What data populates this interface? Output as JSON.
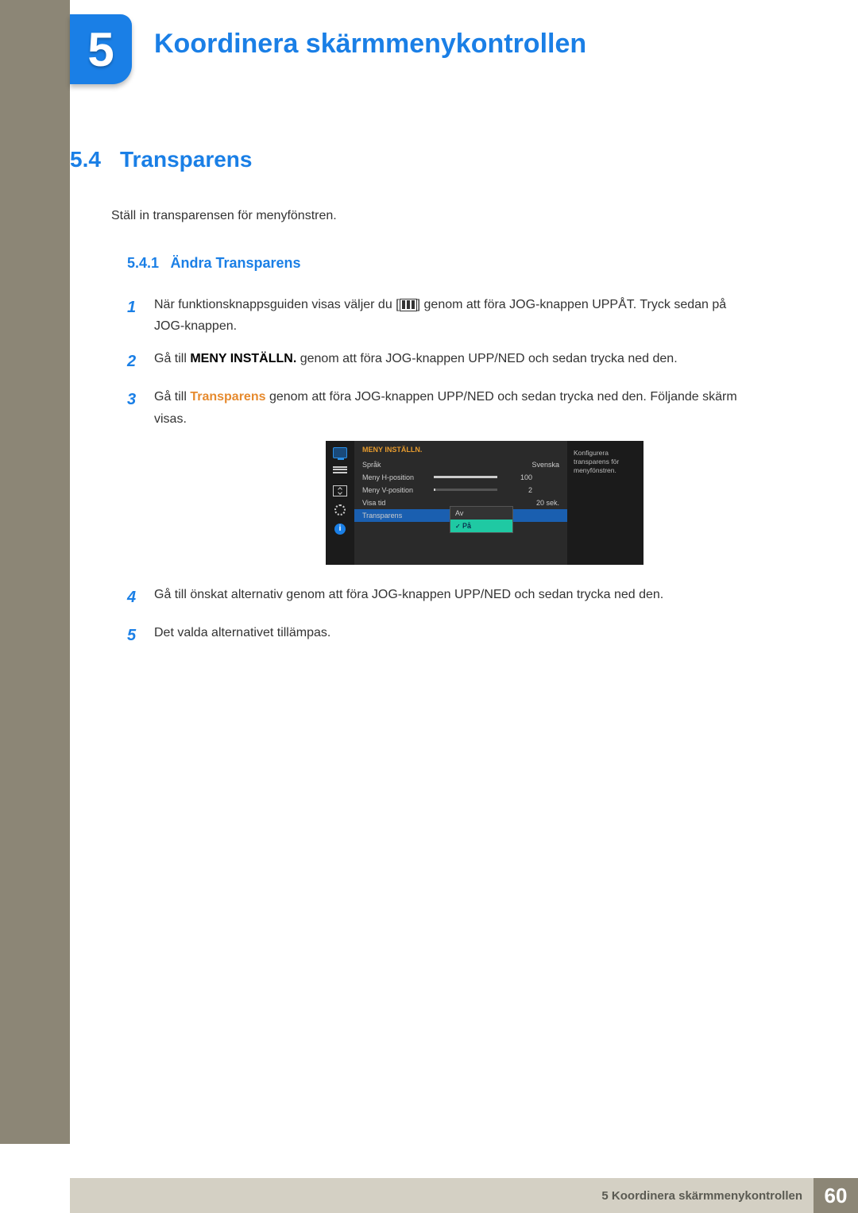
{
  "chapter": {
    "number": "5",
    "title": "Koordinera skärmmenykontrollen"
  },
  "section": {
    "number": "5.4",
    "title": "Transparens"
  },
  "intro": "Ställ in transparensen för menyfönstren.",
  "subsection": {
    "number": "5.4.1",
    "title": "Ändra Transparens"
  },
  "steps": {
    "s1a": "När funktionsknappsguiden visas väljer du [",
    "s1b": "] genom att föra JOG-knappen UPPÅT. Tryck sedan på JOG-knappen.",
    "s2a": "Gå till ",
    "s2bold": "MENY INSTÄLLN.",
    "s2b": " genom att föra JOG-knappen UPP/NED och sedan trycka ned den.",
    "s3a": "Gå till ",
    "s3orange": "Transparens",
    "s3b": " genom att föra JOG-knappen UPP/NED och sedan trycka ned den. Följande skärm visas.",
    "s4": "Gå till önskat alternativ genom att föra JOG-knappen UPP/NED och sedan trycka ned den.",
    "s5": "Det valda alternativet tillämpas."
  },
  "step_nums": {
    "n1": "1",
    "n2": "2",
    "n3": "3",
    "n4": "4",
    "n5": "5"
  },
  "osd": {
    "title": "MENY INSTÄLLN.",
    "rows": {
      "lang_label": "Språk",
      "lang_val": "Svenska",
      "hpos_label": "Meny H-position",
      "hpos_val": "100",
      "vpos_label": "Meny V-position",
      "vpos_val": "2",
      "time_label": "Visa tid",
      "time_val": "20 sek.",
      "trans_label": "Transparens"
    },
    "options": {
      "off": "Av",
      "on": "På"
    },
    "help": "Konfigurera transparens för menyfönstren."
  },
  "footer": {
    "text": "5 Koordinera skärmmenykontrollen",
    "page": "60"
  }
}
